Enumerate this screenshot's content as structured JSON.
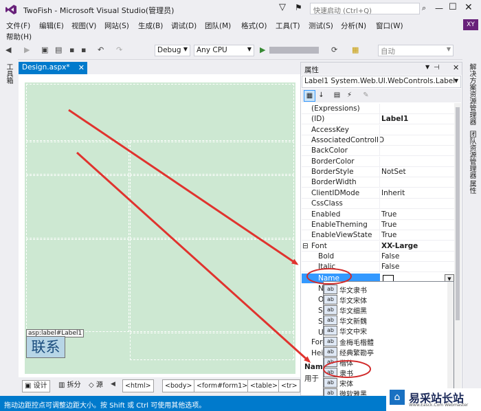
{
  "window": {
    "title": "TwoFish - Microsoft Visual Studio(管理员)",
    "quick_launch_placeholder": "快速启动 (Ctrl+Q)",
    "user_initials": "XY"
  },
  "menu": [
    "文件(F)",
    "编辑(E)",
    "视图(V)",
    "网站(S)",
    "生成(B)",
    "调试(D)",
    "团队(M)",
    "格式(O)",
    "工具(T)",
    "测试(S)",
    "分析(N)",
    "窗口(W)",
    "帮助(H)"
  ],
  "toolbar": {
    "config": "Debug",
    "platform": "Any CPU",
    "run_label": "",
    "auto_combo": "自动"
  },
  "toolbox_tab": "工具箱",
  "document": {
    "tab": "Design.aspx*",
    "label_tag": "asp:label#Label1",
    "label_text": "联系"
  },
  "bottom": {
    "design": "设计",
    "split": "拆分",
    "source": "源",
    "breadcrumbs": [
      "<html>",
      "<body>",
      "<form#form1>",
      "<table>",
      "<tr>"
    ]
  },
  "properties": {
    "title": "属性",
    "object": "Label1 System.Web.UI.WebControls.Label",
    "rows": [
      {
        "name": "(Expressions)",
        "value": ""
      },
      {
        "name": "(ID)",
        "value": "Label1",
        "bold": true
      },
      {
        "name": "AccessKey",
        "value": ""
      },
      {
        "name": "AssociatedControlID",
        "value": ""
      },
      {
        "name": "BackColor",
        "value": ""
      },
      {
        "name": "BorderColor",
        "value": ""
      },
      {
        "name": "BorderStyle",
        "value": "NotSet"
      },
      {
        "name": "BorderWidth",
        "value": ""
      },
      {
        "name": "ClientIDMode",
        "value": "Inherit"
      },
      {
        "name": "CssClass",
        "value": ""
      },
      {
        "name": "Enabled",
        "value": "True"
      },
      {
        "name": "EnableTheming",
        "value": "True"
      },
      {
        "name": "EnableViewState",
        "value": "True"
      },
      {
        "name": "Font",
        "value": "XX-Large",
        "bold": true
      },
      {
        "name": "Bold",
        "value": "False"
      },
      {
        "name": "Italic",
        "value": "False"
      }
    ],
    "name_row": "Name",
    "partial_rows": [
      "Na",
      "Ov",
      "Si",
      "St",
      "Un",
      "Fore",
      "Heig"
    ],
    "desc_title": "Nam",
    "desc_text": "用于"
  },
  "font_dropdown": {
    "icon_label": "ab",
    "options": [
      "华文隶书",
      "华文宋体",
      "华文细黑",
      "华文新魏",
      "华文中宋",
      "金梅毛楷體",
      "经典繁勘亭",
      "楷体",
      "隶书",
      "宋体",
      "微软雅黑"
    ]
  },
  "right_tabs": [
    "解决方案资源管理器",
    "团队资源管理器",
    "属性"
  ],
  "status": "拖动边距控点可调整边距大小。按 Shift 或 Ctrl 可使用其他选项。",
  "watermark": {
    "text": "易采站长站",
    "sub": "Www.Easck.Com Webmaster"
  },
  "colors": {
    "accent": "#007acc",
    "canvas": "#cde8d2",
    "arrow": "#e0332e",
    "highlight": "#3399ff",
    "avatar": "#68217a"
  }
}
